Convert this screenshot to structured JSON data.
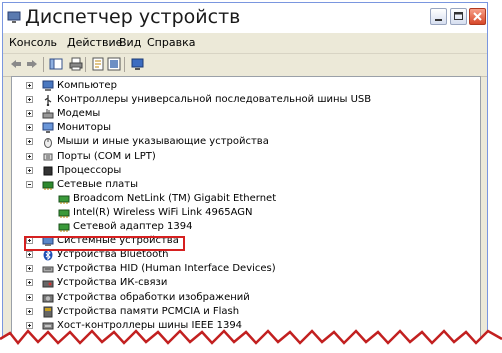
{
  "window": {
    "title": "Диспетчер устройств"
  },
  "menu": [
    {
      "label": "Консоль",
      "name": "menu-console"
    },
    {
      "label": "Действие",
      "name": "menu-action"
    },
    {
      "label": "Вид",
      "name": "menu-view"
    },
    {
      "label": "Справка",
      "name": "menu-help"
    }
  ],
  "toolbar_icons": [
    "back-arrow-icon",
    "forward-arrow-icon",
    "show-hide-tree-icon",
    "print-icon",
    "properties-icon",
    "help-icon",
    "scan-hardware-icon"
  ],
  "tree": [
    {
      "label": "Компьютер",
      "icon": "computer-icon",
      "expander": "plus",
      "indent": 0
    },
    {
      "label": "Контроллеры универсальной последовательной шины USB",
      "icon": "usb-icon",
      "expander": "plus",
      "indent": 0
    },
    {
      "label": "Модемы",
      "icon": "modem-icon",
      "expander": "plus",
      "indent": 0
    },
    {
      "label": "Мониторы",
      "icon": "monitor-icon",
      "expander": "plus",
      "indent": 0
    },
    {
      "label": "Мыши и иные указывающие устройства",
      "icon": "mouse-icon",
      "expander": "plus",
      "indent": 0
    },
    {
      "label": "Порты (COM и LPT)",
      "icon": "port-icon",
      "expander": "plus",
      "indent": 0
    },
    {
      "label": "Процессоры",
      "icon": "processor-icon",
      "expander": "plus",
      "indent": 0
    },
    {
      "label": "Сетевые платы",
      "icon": "network-adapter-icon",
      "expander": "minus",
      "indent": 0
    },
    {
      "label": "Broadcom NetLink (TM) Gigabit Ethernet",
      "icon": "network-card-icon",
      "expander": "none",
      "indent": 1
    },
    {
      "label": "Intel(R) Wireless WiFi Link 4965AGN",
      "icon": "network-card-icon",
      "expander": "none",
      "indent": 1
    },
    {
      "label": "Сетевой адаптер 1394",
      "icon": "network-card-icon",
      "expander": "none",
      "indent": 1
    },
    {
      "label": "Системные устройства",
      "icon": "system-devices-icon",
      "expander": "plus",
      "indent": 0
    },
    {
      "label": "Устройства Bluetooth",
      "icon": "bluetooth-icon",
      "expander": "plus",
      "indent": 0
    },
    {
      "label": "Устройства HID (Human Interface Devices)",
      "icon": "hid-icon",
      "expander": "plus",
      "indent": 0
    },
    {
      "label": "Устройства ИК-связи",
      "icon": "infrared-icon",
      "expander": "plus",
      "indent": 0
    },
    {
      "label": "Устройства обработки изображений",
      "icon": "imaging-icon",
      "expander": "plus",
      "indent": 0
    },
    {
      "label": "Устройства памяти PCMCIA и Flash",
      "icon": "memory-card-icon",
      "expander": "plus",
      "indent": 0
    },
    {
      "label": "Хост-контроллеры шины IEEE 1394",
      "icon": "ieee1394-icon",
      "expander": "plus",
      "indent": 0
    }
  ],
  "highlighted_item": "Устройства Bluetooth",
  "colors": {
    "highlight_border": "#d62020",
    "menu_bg": "#ece9d8"
  }
}
